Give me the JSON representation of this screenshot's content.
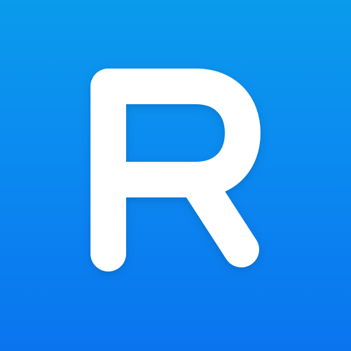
{
  "app_icon": {
    "letter": "R",
    "colors": {
      "gradient_top": "#0a9bec",
      "gradient_mid": "#0b8af0",
      "gradient_bottom": "#0a74ef",
      "glyph": "#ffffff",
      "shadow": "#04447f"
    }
  }
}
